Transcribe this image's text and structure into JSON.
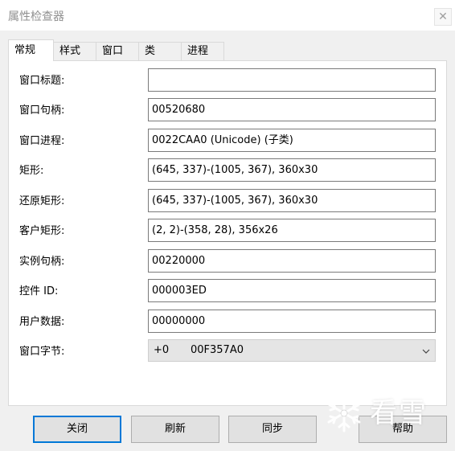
{
  "window": {
    "title": "属性检查器",
    "close_symbol": "✕"
  },
  "tabs": [
    {
      "label": "常规",
      "active": true
    },
    {
      "label": "样式",
      "active": false
    },
    {
      "label": "窗口",
      "active": false
    },
    {
      "label": "类",
      "active": false
    },
    {
      "label": "进程",
      "active": false
    }
  ],
  "fields": [
    {
      "label": "窗口标题:",
      "value": ""
    },
    {
      "label": "窗口句柄:",
      "value": "00520680"
    },
    {
      "label": "窗口进程:",
      "value": "0022CAA0 (Unicode) (子类)"
    },
    {
      "label": "矩形:",
      "value": "(645, 337)-(1005, 367), 360x30"
    },
    {
      "label": "还原矩形:",
      "value": "(645, 337)-(1005, 367), 360x30"
    },
    {
      "label": "客户矩形:",
      "value": "(2, 2)-(358, 28), 356x26"
    },
    {
      "label": "实例句柄:",
      "value": "00220000"
    },
    {
      "label": "控件 ID:",
      "value": "000003ED"
    },
    {
      "label": "用户数据:",
      "value": "00000000"
    }
  ],
  "window_bytes": {
    "label": "窗口字节:",
    "offset": "+0",
    "value": "00F357A0"
  },
  "buttons": {
    "close": "关闭",
    "refresh": "刷新",
    "sync": "同步",
    "help": "帮助"
  },
  "watermark": {
    "text": "看雪"
  },
  "colors": {
    "accent": "#0078d7",
    "background": "#f0f0f0",
    "panel": "#ffffff"
  }
}
